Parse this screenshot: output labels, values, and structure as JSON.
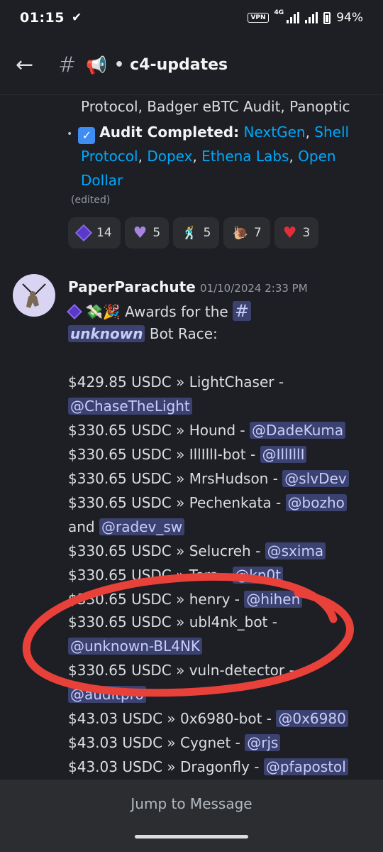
{
  "status_bar": {
    "time": "01:15",
    "check_mark": "✔",
    "vpn": "VPN",
    "network": "4G",
    "battery": "94%"
  },
  "header": {
    "back_icon": "arrow-left-icon",
    "hash": "#",
    "megaphone": "📢",
    "separator": "•",
    "channel": "c4-updates"
  },
  "previous_message": {
    "line1": "Protocol, Badger eBTC Audit, Panoptic",
    "bullet": "•",
    "audit_label": "Audit Completed:",
    "links": [
      "NextGen",
      "Shell Protocol",
      "Dopex",
      "Ethena Labs",
      "Open Dollar"
    ],
    "sep1": ", ",
    "sep2": ", ",
    "sep3": ", ",
    "sep4": ", ",
    "link_shell_a": "Shell",
    "link_shell_b": "Protocol",
    "link_open_a": "Open",
    "link_open_b": "Dollar",
    "edited": "(edited)",
    "reactions": [
      {
        "emoji": "purple-cube",
        "count": "14"
      },
      {
        "emoji": "purple-heart",
        "count": "5"
      },
      {
        "emoji": "dancing-person",
        "count": "5"
      },
      {
        "emoji": "snail",
        "count": "7"
      },
      {
        "emoji": "red-heart",
        "count": "3"
      }
    ]
  },
  "message": {
    "author": "PaperParachute",
    "timestamp": "01/10/2024 2:33 PM",
    "intro_emojis": "💸🎉",
    "intro_text": "Awards for the",
    "channel_hash": "#",
    "channel_name": "unknown",
    "intro_text2": "Bot Race:",
    "awards": [
      {
        "amount": "$429.85 USDC » LightChaser -",
        "mention": "@ChaseTheLight"
      },
      {
        "amount": "$330.65 USDC » Hound -",
        "mention": "@DadeKuma"
      },
      {
        "amount": "$330.65 USDC » IllIllI-bot -",
        "mention": "@IllIllI"
      },
      {
        "amount": "$330.65 USDC » MrsHudson -",
        "mention": "@slvDev"
      },
      {
        "amount": "$330.65 USDC » Pechenkata -",
        "mention": "@bozho"
      },
      {
        "amount": "and",
        "mention": "@radev_sw"
      },
      {
        "amount": "$330.65 USDC » Selucreh -",
        "mention": "@sxima"
      },
      {
        "amount": "$330.65 USDC » Tera -",
        "mention": "@kn0t"
      },
      {
        "amount": "$330.65 USDC » henry -",
        "mention": "@hihen"
      },
      {
        "amount": "$330.65 USDC » ubl4nk_bot -",
        "mention": "@unknown-BL4NK"
      },
      {
        "amount": "$330.65 USDC » vuln-detector -",
        "mention": "@auditpro"
      },
      {
        "amount": "$43.03 USDC » 0x6980-bot -",
        "mention": "@0x6980"
      },
      {
        "amount": "$43.03 USDC » Cygnet -",
        "mention": "@rjs"
      },
      {
        "amount": "$43.03 USDC » Dragonfly -",
        "mention": "@pfapostol"
      }
    ]
  },
  "jump_button": "Jump to Message",
  "colors": {
    "background": "#1e1f24",
    "link": "#00a8fc",
    "mention_bg": "#3c4270",
    "annotation": "#e8413a"
  }
}
